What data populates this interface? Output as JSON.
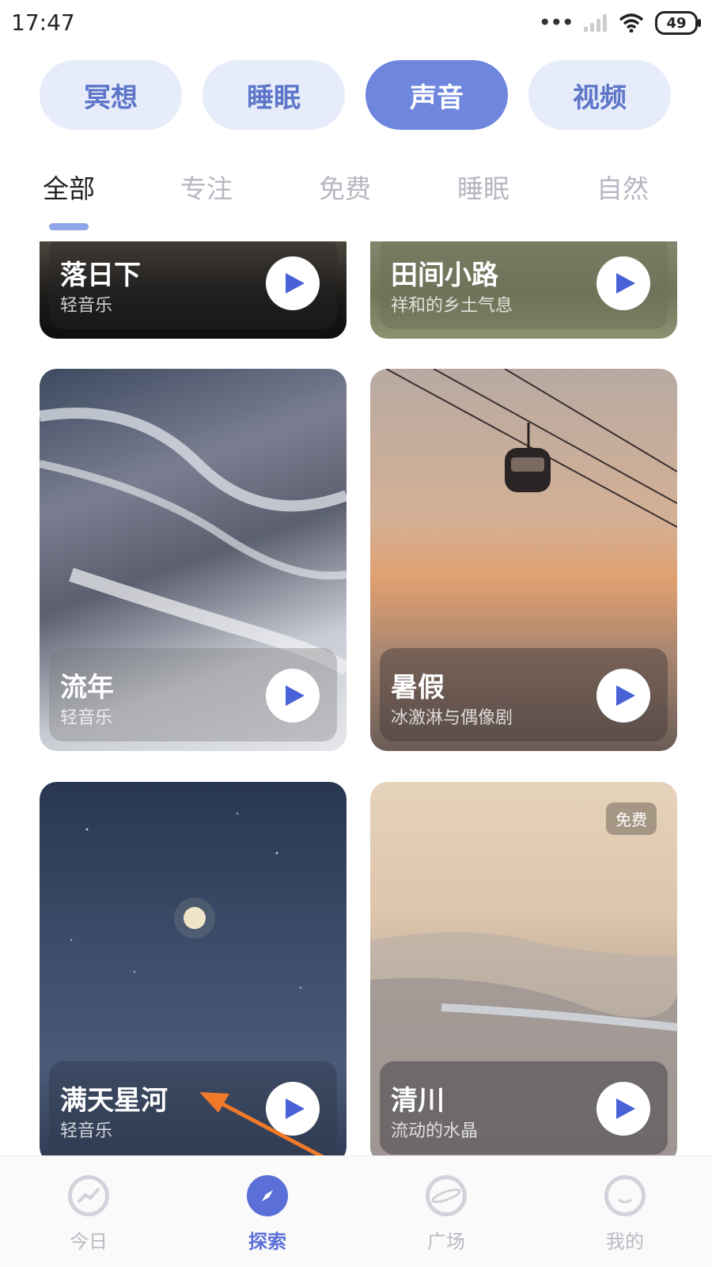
{
  "status_bar": {
    "time": "17:47",
    "battery": "49"
  },
  "category_pills": [
    {
      "label": "冥想"
    },
    {
      "label": "睡眠"
    },
    {
      "label": "声音",
      "active": true
    },
    {
      "label": "视频"
    }
  ],
  "sub_tabs": [
    {
      "label": "全部",
      "active": true
    },
    {
      "label": "专注"
    },
    {
      "label": "免费"
    },
    {
      "label": "睡眠"
    },
    {
      "label": "自然"
    }
  ],
  "cards": [
    {
      "title": "落日下",
      "subtitle": "轻音乐"
    },
    {
      "title": "田间小路",
      "subtitle": "祥和的乡土气息"
    },
    {
      "title": "流年",
      "subtitle": "轻音乐"
    },
    {
      "title": "暑假",
      "subtitle": "冰激淋与偶像剧"
    },
    {
      "title": "满天星河",
      "subtitle": "轻音乐"
    },
    {
      "title": "清川",
      "subtitle": "流动的水晶",
      "badge": "免费"
    }
  ],
  "bottom_nav": [
    {
      "label": "今日",
      "icon": "chart-icon"
    },
    {
      "label": "探索",
      "icon": "compass-icon",
      "active": true
    },
    {
      "label": "广场",
      "icon": "planet-icon"
    },
    {
      "label": "我的",
      "icon": "profile-icon"
    }
  ],
  "colors": {
    "accent": "#5b6fd8",
    "pill_bg": "#e7ecfb",
    "pill_active": "#6e86de"
  }
}
